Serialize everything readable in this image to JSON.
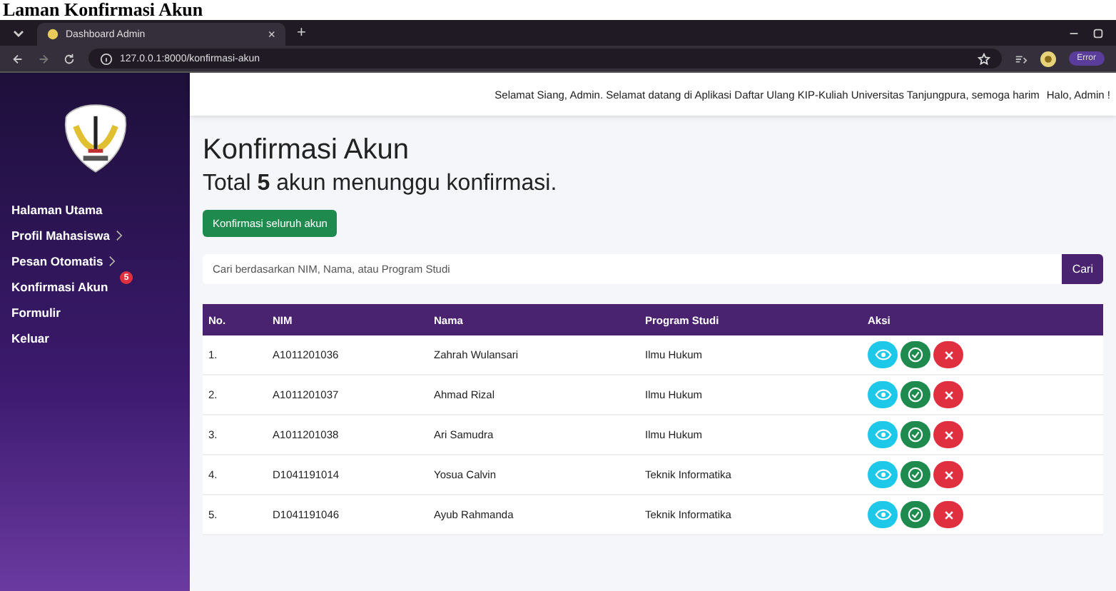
{
  "caption": "Laman Konfirmasi Akun",
  "browser": {
    "tab_title": "Dashboard Admin",
    "tab_close": "×",
    "new_tab": "+",
    "url": "127.0.0.1:8000/konfirmasi-akun",
    "profile_button": "Error"
  },
  "sidebar": {
    "items": [
      {
        "label": "Halaman Utama",
        "has_submenu": false
      },
      {
        "label": "Profil Mahasiswa",
        "has_submenu": true
      },
      {
        "label": "Pesan Otomatis",
        "has_submenu": true
      },
      {
        "label": "Konfirmasi Akun",
        "has_submenu": false,
        "badge": "5"
      },
      {
        "label": "Formulir",
        "has_submenu": false
      },
      {
        "label": "Keluar",
        "has_submenu": false
      }
    ]
  },
  "header": {
    "greeting": "Selamat Siang, Admin. Selamat datang di Aplikasi Daftar Ulang KIP-Kuliah Universitas Tanjungpura, semoga harim",
    "user": "Halo, Admin !"
  },
  "title": "Konfirmasi Akun",
  "summary": "Total **5** akun menunggu konfirmasi.",
  "confirm_all_button": "Konfirmasi seluruh akun",
  "search": {
    "placeholder": "Cari berdasarkan NIM, Nama, atau Program Studi",
    "button": "Cari"
  },
  "table": {
    "columns": [
      "No.",
      "NIM",
      "Nama",
      "Program Studi",
      "Aksi"
    ],
    "rows": [
      {
        "no": "1.",
        "nim": "A1011201036",
        "nama": "Zahrah Wulansari",
        "prodi": "Ilmu Hukum"
      },
      {
        "no": "2.",
        "nim": "A1011201037",
        "nama": "Ahmad Rizal",
        "prodi": "Ilmu Hukum"
      },
      {
        "no": "3.",
        "nim": "A1011201038",
        "nama": "Ari Samudra",
        "prodi": "Ilmu Hukum"
      },
      {
        "no": "4.",
        "nim": "D1041191014",
        "nama": "Yosua Calvin",
        "prodi": "Teknik Informatika"
      },
      {
        "no": "5.",
        "nim": "D1041191046",
        "nama": "Ayub Rahmanda",
        "prodi": "Teknik Informatika"
      }
    ]
  }
}
